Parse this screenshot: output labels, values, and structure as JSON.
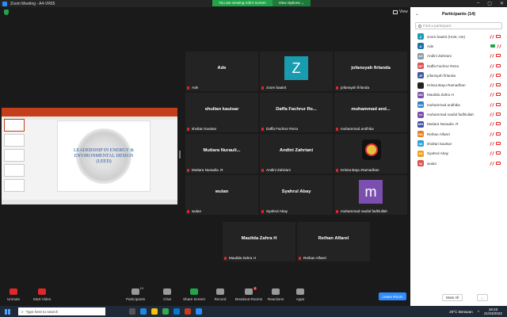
{
  "window": {
    "title": "Zoom Meeting - A4-VR65"
  },
  "banner": {
    "message": "You are viewing Ade's screen",
    "options_label": "View Options ⌄"
  },
  "view": {
    "label": "View"
  },
  "shared_slide": {
    "title_text": "LEADERSHIP IN ENERGY & ENVIRONMENTAL DESIGN (LEED)"
  },
  "tiles": [
    {
      "display": "Ade",
      "label": "Ade",
      "type": "name"
    },
    {
      "display": "Z",
      "label": "zoom baa04",
      "type": "avatar",
      "color": "#1a9cb0"
    },
    {
      "display": "jofansyah firlanda",
      "label": "jofansyah firlanda",
      "type": "name"
    },
    {
      "display": "shultan kautsar",
      "label": "shultan kautsar",
      "type": "name"
    },
    {
      "display": "Daffa Fachrur Re...",
      "label": "Daffa Fachrur Reza",
      "type": "name"
    },
    {
      "display": "muhammad and...",
      "label": "muhammad andhika",
      "type": "name"
    },
    {
      "display": "Mutiara Nurauli...",
      "label": "Mutiara Nuraulia .R",
      "type": "name"
    },
    {
      "display": "Andini Zahriani",
      "label": "Andini Zahriani",
      "type": "name"
    },
    {
      "display": "",
      "label": "Krisna Bayu Ramadhan",
      "type": "photo"
    },
    {
      "display": "wulan",
      "label": "wulan",
      "type": "name"
    },
    {
      "display": "Syahrul Abay",
      "label": "Syahrul Abay",
      "type": "name"
    },
    {
      "display": "m",
      "label": "muhammad naufal fadhlullah",
      "type": "avatar",
      "color": "#7b4fb0"
    },
    {
      "display": "Maulida Zahra H",
      "label": "Maulida Zahra H",
      "type": "name"
    },
    {
      "display": "Reihan Alfarel",
      "label": "Reihan Alfarel",
      "type": "name"
    }
  ],
  "toolbar": {
    "unmute": "Unmute",
    "start_video": "Start Video",
    "participants": "Participants",
    "participants_count": "14",
    "chat": "Chat",
    "share_screen": "Share Screen",
    "record": "Record",
    "breakout": "Breakout Rooms",
    "breakout_badge": "1",
    "reactions": "Reactions",
    "apps": "Apps",
    "leave": "Leave Room"
  },
  "panel": {
    "title": "Participants (14)",
    "search_placeholder": "Find a participant",
    "mute_all": "Mute All",
    "more": "...",
    "participants": [
      {
        "initials": "Z",
        "name": "zoom baa04 (Host, me)",
        "color": "#1a9cb0",
        "cam": "off"
      },
      {
        "initials": "A",
        "name": "Ade",
        "color": "#1a6fb0",
        "cam": "on"
      },
      {
        "initials": "AZ",
        "name": "Andini Zahriani",
        "color": "#8a9aa8",
        "cam": "off"
      },
      {
        "initials": "DF",
        "name": "Daffa Fachrur Reza",
        "color": "#d9534f",
        "cam": "off"
      },
      {
        "initials": "JF",
        "name": "jofansyah firlanda",
        "color": "#3b5998",
        "cam": "off"
      },
      {
        "initials": "",
        "name": "Krisna Bayu Ramadhan",
        "color": "#222222",
        "cam": "off"
      },
      {
        "initials": "MZ",
        "name": "Maulida Zahra H",
        "color": "#7b4fb0",
        "cam": "off"
      },
      {
        "initials": "MA",
        "name": "muhammad andhika",
        "color": "#2a7fc4",
        "cam": "off"
      },
      {
        "initials": "m",
        "name": "muhammad naufal fadhlullah",
        "color": "#7b4fb0",
        "cam": "off"
      },
      {
        "initials": "MN",
        "name": "Mutiara Nuraulia .R",
        "color": "#3f4ea8",
        "cam": "off"
      },
      {
        "initials": "RA",
        "name": "Reihan Alfarel",
        "color": "#e67e22",
        "cam": "off"
      },
      {
        "initials": "SK",
        "name": "shultan kautsar",
        "color": "#2a9ed8",
        "cam": "off"
      },
      {
        "initials": "SA",
        "name": "Syahrul Abay",
        "color": "#f39c12",
        "cam": "off"
      },
      {
        "initials": "W",
        "name": "wulan",
        "color": "#d9534f",
        "cam": "off"
      }
    ]
  },
  "taskbar": {
    "search_placeholder": "Type here to search",
    "weather": "29°C  Berawan",
    "time": "18:43",
    "date": "21/03/2022"
  }
}
